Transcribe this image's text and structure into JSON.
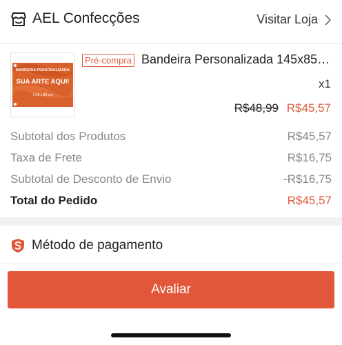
{
  "header": {
    "shop_icon": "storefront-icon",
    "shop_name": "AEL Confecções",
    "visit_shop_label": "Visitar Loja",
    "chevron_icon": "chevron-right-icon"
  },
  "product": {
    "thumbnail": {
      "icon": "product-image",
      "title_text": "BANDEIRA PERSONALIZADA",
      "main_text": "SUA ARTE AQUI!",
      "size_text": "1,45 x 85 cm"
    },
    "tag": "Pré-compra",
    "name": "Bandeira Personalizada 145x85…",
    "quantity": "x1",
    "original_price": "R$48,99",
    "price": "R$45,57"
  },
  "summary": {
    "rows": [
      {
        "label": "Subtotal dos Produtos",
        "value": "R$45,57"
      },
      {
        "label": "Taxa de Frete",
        "value": "R$16,75"
      },
      {
        "label": "Subtotal de Desconto de Envio",
        "value": "-R$16,75"
      }
    ],
    "total": {
      "label": "Total do Pedido",
      "value": "R$45,57"
    }
  },
  "payment": {
    "icon": "shield-s-icon",
    "title": "Método de pagamento"
  },
  "footer": {
    "rate_button_label": "Avaliar"
  },
  "colors": {
    "accent": "#e0593d",
    "button": "#e2573b",
    "muted_text": "#888888"
  }
}
